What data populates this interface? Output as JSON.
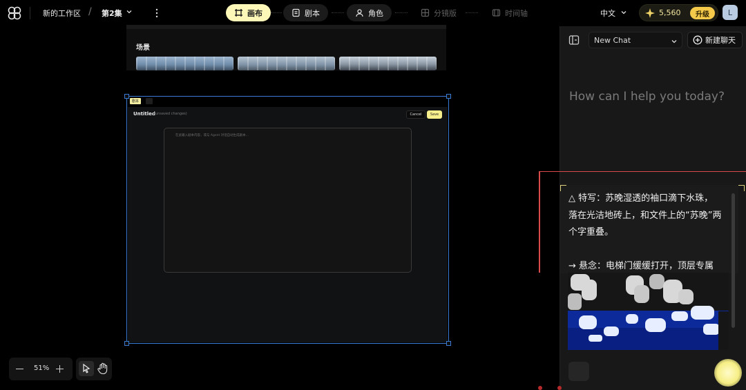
{
  "header": {
    "workspace": "新的工作区",
    "separator": "/",
    "episode": "第2集",
    "tabs": [
      {
        "label": "画布",
        "icon": "canvas-icon",
        "state": "active"
      },
      {
        "label": "剧本",
        "icon": "script-icon",
        "state": "normal"
      },
      {
        "label": "角色",
        "icon": "character-icon",
        "state": "normal"
      },
      {
        "label": "分镜版",
        "icon": "storyboard-icon",
        "state": "disabled"
      },
      {
        "label": "时间轴",
        "icon": "timeline-icon",
        "state": "disabled"
      }
    ],
    "language": "中文",
    "credits": "5,560",
    "upgrade_label": "升级",
    "avatar_initial": "L"
  },
  "canvas": {
    "scene_section_title": "场景",
    "script_node": {
      "tag": "剧本",
      "title": "Untitled",
      "status": "(unsaved changes)",
      "cancel_label": "Cancel",
      "save_label": "Save",
      "editor_placeholder": "在此输入剧本内容，或与 Agent 对话自动生成剧本..."
    },
    "zoom": "51%"
  },
  "chat": {
    "chat_select": "New Chat",
    "new_chat_label": "新建聊天",
    "help_text": "How can I help you today?",
    "message_lines": [
      "△ 特写：苏晚湿透的袖口滴下水珠，",
      "落在光洁地砖上，和文件上的“苏晚”两",
      "个字重叠。",
      "→ 悬念：电梯门缓缓打开，顶层专属"
    ]
  },
  "colors": {
    "accent_yellow": "#fdf7b8",
    "selection_blue": "#3a7bd5",
    "highlight_red": "#d94a4a",
    "upgrade_gold": "#f5c94a"
  }
}
